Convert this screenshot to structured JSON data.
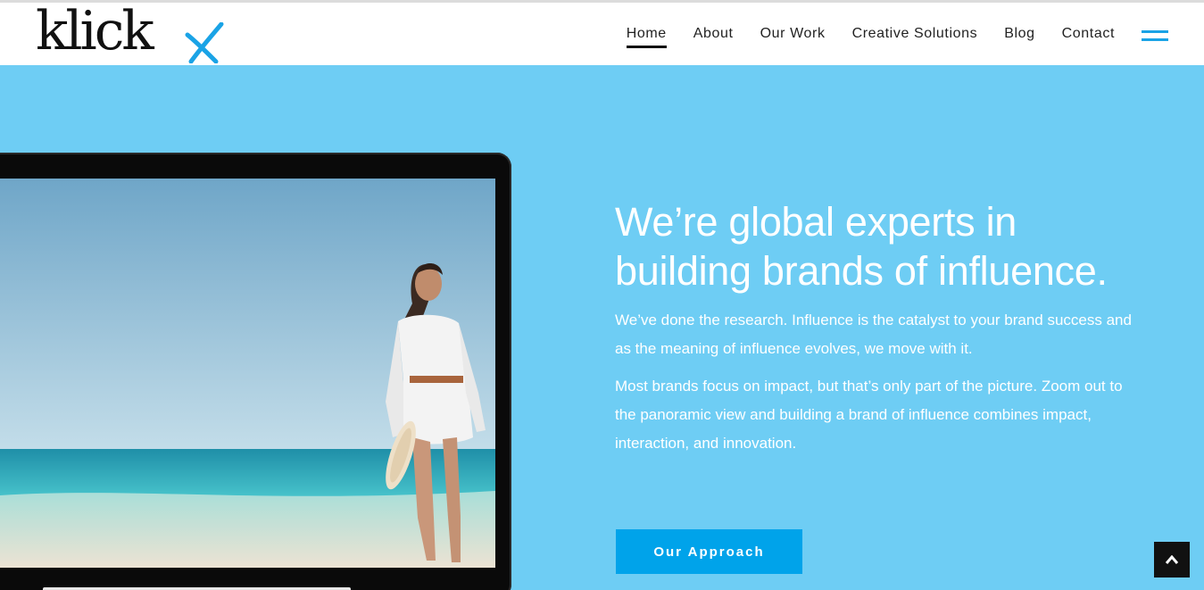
{
  "brand": {
    "logo_text": "klick",
    "logo_mark": "x-mark-logo",
    "accent_color": "#1aa3e6"
  },
  "nav": {
    "items": [
      {
        "label": "Home",
        "active": true
      },
      {
        "label": "About",
        "active": false
      },
      {
        "label": "Our Work",
        "active": false
      },
      {
        "label": "Creative Solutions",
        "active": false
      },
      {
        "label": "Blog",
        "active": false
      },
      {
        "label": "Contact",
        "active": false
      }
    ],
    "menu_icon": "hamburger-icon"
  },
  "hero": {
    "background_color": "#6ecdf4",
    "headline": "We’re global experts in building brands of influence.",
    "paragraph_1": "We’ve done the research. Influence is the catalyst to your brand success and as the meaning of influence evolves, we move with it.",
    "paragraph_2": "Most brands focus on impact, but that’s only part of the picture. Zoom out to the panoramic view and building a brand of influence combines impact, interaction, and innovation.",
    "cta_label": "Our Approach",
    "cta_color": "#00a3ea",
    "image": "laptop-beach-woman-photo"
  },
  "scroll_top_icon": "chevron-up-icon"
}
